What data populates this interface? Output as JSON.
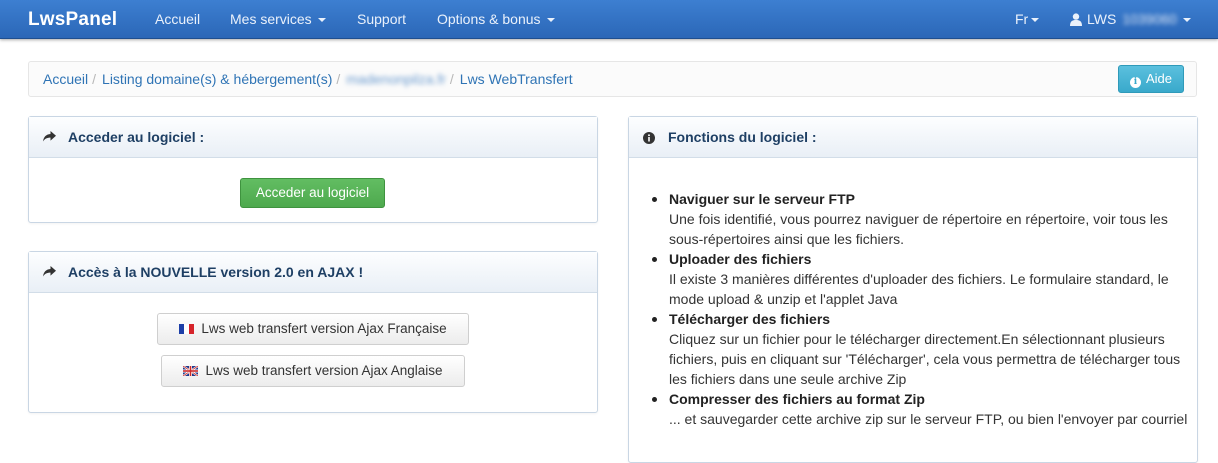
{
  "navbar": {
    "brand": "LwsPanel",
    "items": [
      {
        "label": "Accueil"
      },
      {
        "label": "Mes services"
      },
      {
        "label": "Support"
      },
      {
        "label": "Options & bonus"
      }
    ],
    "language": "Fr",
    "user_prefix": "LWS",
    "user_id_blurred": "1039060"
  },
  "breadcrumb": {
    "items": [
      {
        "label": "Accueil"
      },
      {
        "label": "Listing domaine(s) & hébergement(s)"
      },
      {
        "label": "madenonpilza.fr"
      },
      {
        "label": "Lws WebTransfert"
      }
    ],
    "help_label": "Aide"
  },
  "access_panel": {
    "title": "Acceder au logiciel :",
    "button_label": "Acceder au logiciel"
  },
  "ajax_panel": {
    "title": "Accès à la NOUVELLE version 2.0 en AJAX !",
    "buttons": [
      {
        "label": "Lws web transfert version Ajax Française",
        "flag": "flag-fr-icon"
      },
      {
        "label": "Lws web transfert version Ajax Anglaise",
        "flag": "flag-uk-icon"
      }
    ]
  },
  "functions_panel": {
    "title": "Fonctions du logiciel :",
    "items": [
      {
        "title": "Naviguer sur le serveur FTP",
        "desc": "Une fois identifié, vous pourrez naviguer de répertoire en répertoire, voir tous les sous-répertoires ainsi que les fichiers."
      },
      {
        "title": "Uploader des fichiers",
        "desc": "Il existe 3 manières différentes d'uploader des fichiers. Le formulaire standard, le mode upload & unzip et l'applet Java"
      },
      {
        "title": "Télécharger des fichiers",
        "desc": "Cliquez sur un fichier pour le télécharger directement.En sélectionnant plusieurs fichiers, puis en cliquant sur 'Télécharger', cela vous permettra de télécharger tous les fichiers dans une seule archive Zip"
      },
      {
        "title": "Compresser des fichiers au format Zip",
        "desc": "... et sauvegarder cette archive zip sur le serveur FTP, ou bien l'envoyer par courriel"
      }
    ]
  },
  "colors": {
    "navbar": "#2f6fc2",
    "link": "#2f74b5",
    "success": "#5cb85c",
    "info": "#5bc0de"
  }
}
